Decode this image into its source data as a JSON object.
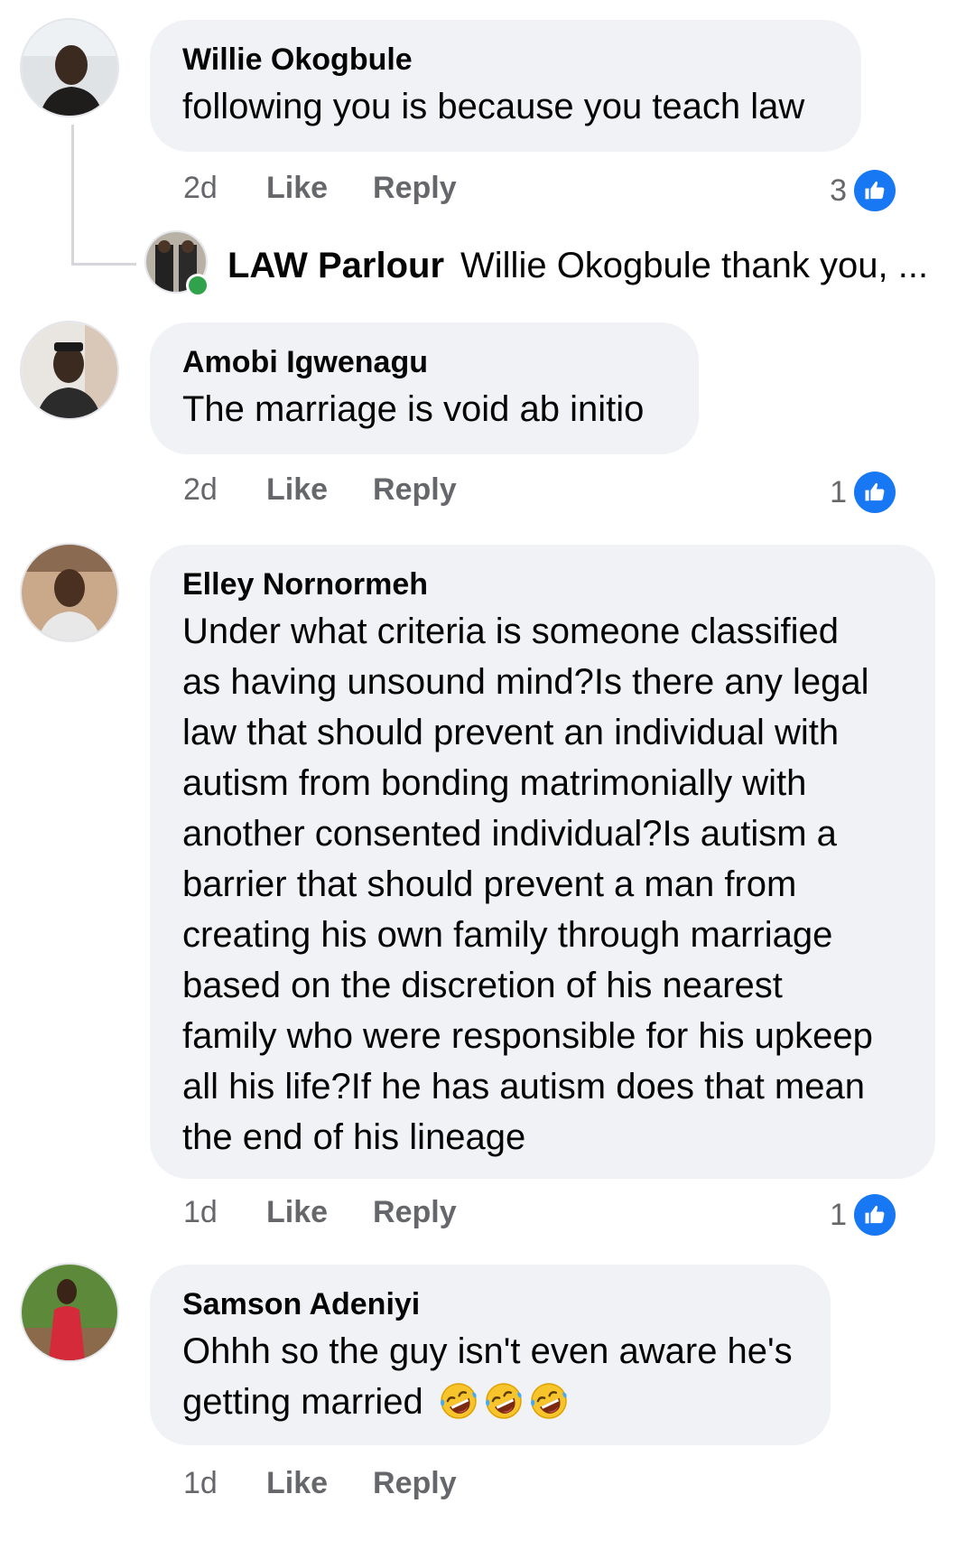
{
  "colors": {
    "bubble_bg": "#f0f2f5",
    "meta_text": "#65676b",
    "like_blue": "#1877f2",
    "online_green": "#31a24c"
  },
  "comments": [
    {
      "author": "Willie Okogbule",
      "text": "following you is because you teach law",
      "time": "2d",
      "like_label": "Like",
      "reply_label": "Reply",
      "reaction_count": "3",
      "reaction_icon": "thumbs-up-icon",
      "reply": {
        "author": "LAW Parlour",
        "text": "Willie Okogbule thank you, ..."
      }
    },
    {
      "author": "Amobi Igwenagu",
      "text": "The marriage is void ab initio",
      "time": "2d",
      "like_label": "Like",
      "reply_label": "Reply",
      "reaction_count": "1",
      "reaction_icon": "thumbs-up-icon"
    },
    {
      "author": "Elley Nornormeh",
      "text_lines": [
        "Under what criteria is someone classified",
        "as having unsound mind?Is there any legal",
        "law that should prevent an individual with",
        "autism from bonding matrimonially with",
        "another consented individual?Is autism a",
        "barrier that should prevent a man from",
        "creating his own family through marriage",
        "based on the discretion of his nearest",
        "family who were responsible for his upkeep",
        "all his life?If he has autism does that mean",
        "the end of his lineage"
      ],
      "time": "1d",
      "like_label": "Like",
      "reply_label": "Reply",
      "reaction_count": "1",
      "reaction_icon": "thumbs-up-icon"
    },
    {
      "author": "Samson Adeniyi",
      "text_line1": "Ohhh so the guy isn't even aware he's",
      "text_line2": "getting married",
      "emojis": [
        "rolling-on-floor-laughing-emoji",
        "rolling-on-floor-laughing-emoji",
        "rolling-on-floor-laughing-emoji"
      ],
      "time": "1d",
      "like_label": "Like",
      "reply_label": "Reply"
    }
  ]
}
